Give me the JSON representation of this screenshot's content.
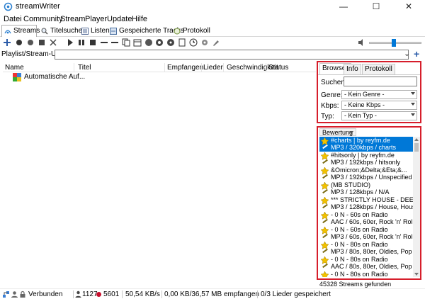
{
  "window": {
    "title": "streamWriter",
    "min": "—",
    "max": "☐",
    "close": "✕"
  },
  "menu": [
    "Datei",
    "Community",
    "Stream",
    "Player",
    "Update",
    "Hilfe"
  ],
  "tabs": [
    "Streams",
    "Titelsuche",
    "Listen",
    "Gespeicherte Tracks",
    "Protokoll"
  ],
  "url": {
    "label": "Playlist/Stream-URL:",
    "value": ""
  },
  "list": {
    "columns": [
      "Name",
      "Titel",
      "Empfangen",
      "Lieder",
      "Geschwindigkeit",
      "Status"
    ],
    "rows": [
      {
        "name": "Automatische Auf..."
      }
    ]
  },
  "browser": {
    "tabs": [
      "Browser",
      "Info",
      "Protokoll"
    ],
    "search_label": "Suchen:",
    "search_value": "",
    "genre_label": "Genre:",
    "genre_value": "- Kein Genre -",
    "kbps_label": "Kbps:",
    "kbps_value": "- Keine Kbps -",
    "typ_label": "Typ:",
    "typ_value": "- Kein Typ -"
  },
  "stations": {
    "sort_label": "Bewertung",
    "items": [
      {
        "l1": "#charts | by reyfm.de",
        "l2": "MP3 / 320kbps / charts"
      },
      {
        "l1": "#hitsonly | by reyfm.de",
        "l2": "MP3 / 192kbps / hitsonly"
      },
      {
        "l1": "&Omicron;&Delta;&Eta;&...",
        "l2": "MP3 / 192kbps / Unspecified"
      },
      {
        "l1": "(MB STUDIO)",
        "l2": "MP3 / 128kbps / N/A"
      },
      {
        "l1": "*** STRICTLY HOUSE - DEEP ...",
        "l2": "MP3 / 128kbps / House, House Mu"
      },
      {
        "l1": "- 0 N - 60s on Radio",
        "l2": "AAC / 60s, 60er, Rock 'n' Roll, Twi"
      },
      {
        "l1": "- 0 N - 60s on Radio",
        "l2": "MP3 / 60s, 60er, Rock 'n' Roll, Twi"
      },
      {
        "l1": "- 0 N - 80s on Radio",
        "l2": "MP3 / 80s, 80er, Oldies, Pop"
      },
      {
        "l1": "- 0 N - 80s on Radio",
        "l2": "AAC / 80s, 80er, Oldies, Pop"
      },
      {
        "l1": "- 0 N - 80s on Radio",
        "l2": ""
      }
    ],
    "found": "45328 Streams gefunden"
  },
  "status": {
    "connection": "Verbunden",
    "count_a": "1127",
    "count_b": "5601",
    "speed": "50,54 KB/s",
    "received": "0,00 KB/36,57 MB empfangen",
    "saved": "0/3 Lieder gespeichert"
  },
  "colors": {
    "highlight": "#d61e2b",
    "selection": "#0078d7"
  }
}
